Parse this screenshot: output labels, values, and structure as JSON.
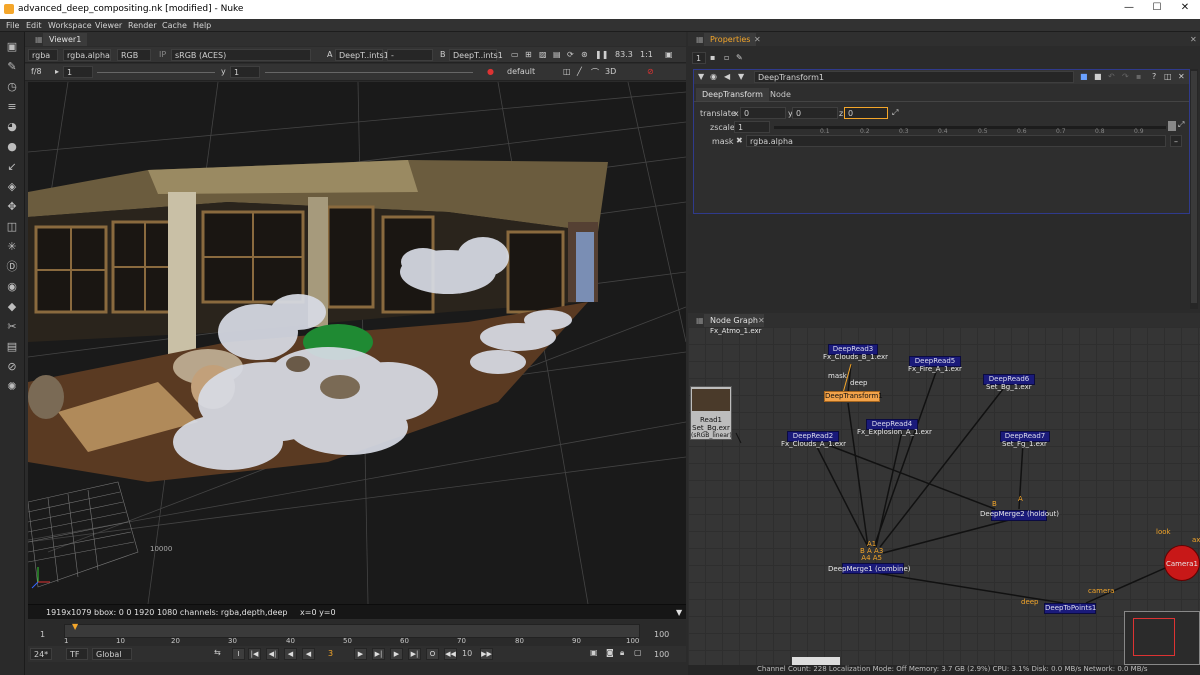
{
  "window": {
    "title": "advanced_deep_compositing.nk [modified] - Nuke",
    "minimize": "—",
    "maximize": "☐",
    "close": "✕"
  },
  "menu": [
    "File",
    "Edit",
    "Workspace",
    "Viewer",
    "Render",
    "Cache",
    "Help"
  ],
  "viewer": {
    "tab": "Viewer1",
    "channels": "rgba",
    "alpha": "rgba.alpha",
    "colorspace_model": "RGB",
    "ip": "IP",
    "lut": "sRGB (ACES)",
    "input_a_label": "A",
    "input_a": "DeepT..ints1",
    "dash": "-",
    "input_b_label": "B",
    "input_b": "DeepT..ints1",
    "zoom": "83.3",
    "ratio": "1:1",
    "fstop": "f/8",
    "gain": "1",
    "y_label": "y",
    "gamma": "1",
    "lookup": "default",
    "mode": "3D",
    "grid_label": "10000",
    "info_text": "1919x1079  bbox: 0 0 1920 1080 channels: rgba,depth,deep",
    "coords_text": "x=0 y=0"
  },
  "timeline": {
    "start": "1",
    "end": "100",
    "ticks": [
      "1",
      "10",
      "20",
      "30",
      "40",
      "50",
      "60",
      "70",
      "80",
      "90",
      "100"
    ],
    "current_frame": "3",
    "fps": "24*",
    "tf": "TF",
    "scope": "Global",
    "step": "10",
    "end_frame": "100"
  },
  "properties": {
    "tab": "Properties",
    "count": "1",
    "node_name": "DeepTransform1",
    "tabs": [
      "DeepTransform",
      "Node"
    ],
    "translate_label": "translate",
    "x_label": "x",
    "x_val": "0",
    "y_label": "y",
    "y_val": "0",
    "z_label": "z",
    "z_val": "0",
    "zscale_label": "zscale",
    "zscale_val": "1",
    "slider_ticks": [
      "0.1",
      "0.2",
      "0.3",
      "0.4",
      "0.5",
      "0.6",
      "0.7",
      "0.8",
      "0.9"
    ],
    "mask_label": "mask",
    "mask_val": "rgba.alpha"
  },
  "nodegraph": {
    "tab": "Node Graph",
    "nodes": {
      "atmo": "Fx_Atmo_1.exr",
      "dr3": "DeepRead3",
      "dr3_file": "Fx_Clouds_B_1.exr",
      "dr5": "DeepRead5",
      "dr5_file": "Fx_Fire_A_1.exr",
      "dr6": "DeepRead6",
      "dr6_file": "Set_Bg_1.exr",
      "mask_lbl": "mask",
      "deep_lbl": "deep",
      "dt1": "DeepTransform1",
      "read1": "Read1",
      "read1_file": "Set_Bg.exr",
      "read1_cs": "(sRGB_linear)",
      "dr4": "DeepRead4",
      "dr4_file": "Fx_Explosion_A_1.exr",
      "dr2": "DeepRead2",
      "dr2_file": "Fx_Clouds_A_1.exr",
      "dr7": "DeepRead7",
      "dr7_file": "Set_Fg_1.exr",
      "b_in": "B",
      "a_in": "A",
      "dm2": "DeepMerge2 (holdout)",
      "dm1_inputs": "A1\nB A A3\nA4 A5",
      "dm1": "DeepMerge1 (combine)",
      "look": "look",
      "ax": "ax",
      "camera": "Camera1",
      "camera_in": "camera",
      "deep_in": "deep",
      "dtp": "DeepToPoints1"
    }
  },
  "status": "Channel Count: 228  Localization Mode: Off  Memory: 3.7 GB (2.9%)  CPU: 3.1%  Disk: 0.0 MB/s  Network: 0.0 MB/s",
  "colors": {
    "accent": "#f4a62a",
    "node_blue": "#1a1a7a",
    "camera_red": "#c81818",
    "panel_border": "#2f3a8c"
  }
}
